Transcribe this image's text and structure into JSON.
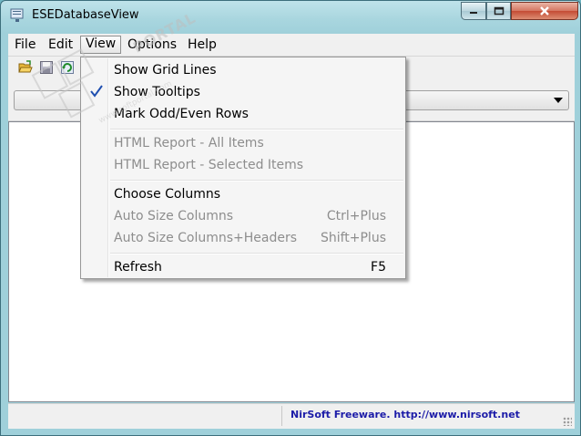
{
  "window": {
    "title": "ESEDatabaseView"
  },
  "menubar": {
    "items": [
      "File",
      "Edit",
      "View",
      "Options",
      "Help"
    ],
    "active": "View"
  },
  "toolbar": {
    "buttons": [
      "open-icon",
      "save-icon",
      "refresh-icon"
    ]
  },
  "view_menu": {
    "items": [
      {
        "label": "Show Grid Lines",
        "shortcut": "",
        "enabled": true,
        "checked": false
      },
      {
        "label": "Show Tooltips",
        "shortcut": "",
        "enabled": true,
        "checked": true
      },
      {
        "label": "Mark Odd/Even Rows",
        "shortcut": "",
        "enabled": true,
        "checked": false
      },
      {
        "label": "HTML Report - All Items",
        "shortcut": "",
        "enabled": false,
        "checked": false
      },
      {
        "label": "HTML Report - Selected Items",
        "shortcut": "",
        "enabled": false,
        "checked": false
      },
      {
        "label": "Choose Columns",
        "shortcut": "",
        "enabled": true,
        "checked": false
      },
      {
        "label": "Auto Size Columns",
        "shortcut": "Ctrl+Plus",
        "enabled": false,
        "checked": false
      },
      {
        "label": "Auto Size Columns+Headers",
        "shortcut": "Shift+Plus",
        "enabled": false,
        "checked": false
      },
      {
        "label": "Refresh",
        "shortcut": "F5",
        "enabled": true,
        "checked": false
      }
    ]
  },
  "statusbar": {
    "pane1": "",
    "link": "NirSoft Freeware.  http://www.nirsoft.net"
  },
  "watermark": {
    "text": "PORTAL",
    "url": "www.softportal.com"
  },
  "colors": {
    "desktop": "#6fb6c3",
    "link": "#1c1ca8",
    "disabled_text": "#8d8d8d",
    "check": "#1f4fb0"
  }
}
